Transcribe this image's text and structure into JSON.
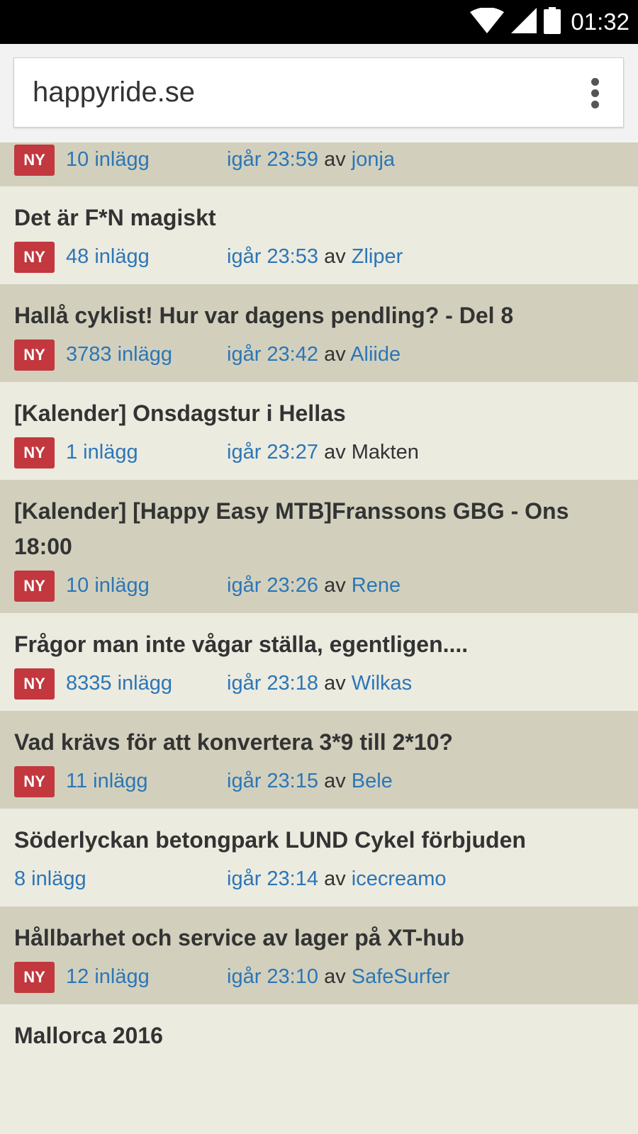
{
  "status_bar": {
    "time": "01:32",
    "icons": [
      "wifi-icon",
      "signal-icon",
      "battery-icon"
    ]
  },
  "browser": {
    "url": "happyride.se",
    "menu_icon": "overflow-menu-icon"
  },
  "colors": {
    "row_dark": "#d2d0bd",
    "row_light": "#ecebe0",
    "badge": "#c2383e",
    "link": "#2c76b6"
  },
  "threads": [
    {
      "title": "",
      "new_badge": "NY",
      "posts": "10 inlägg",
      "time": "igår 23:59",
      "by": "av",
      "user": "jonja"
    },
    {
      "title": "Det är F*N magiskt",
      "new_badge": "NY",
      "posts": "48 inlägg",
      "time": "igår 23:53",
      "by": "av",
      "user": "Zliper"
    },
    {
      "title": "Hallå cyklist! Hur var dagens pendling? - Del 8",
      "new_badge": "NY",
      "posts": "3783 inlägg",
      "time": "igår 23:42",
      "by": "av",
      "user": "Aliide"
    },
    {
      "title": "[Kalender] Onsdagstur i Hellas",
      "new_badge": "NY",
      "posts": "1 inlägg",
      "time": "igår 23:27",
      "by": "av",
      "user": "Makten"
    },
    {
      "title": "[Kalender] [Happy Easy MTB]Franssons GBG - Ons 18:00",
      "new_badge": "NY",
      "posts": "10 inlägg",
      "time": "igår 23:26",
      "by": "av",
      "user": "Rene"
    },
    {
      "title": "Frågor man inte vågar ställa, egentligen....",
      "new_badge": "NY",
      "posts": "8335 inlägg",
      "time": "igår 23:18",
      "by": "av",
      "user": "Wilkas"
    },
    {
      "title": "Vad krävs för att konvertera 3*9 till 2*10?",
      "new_badge": "NY",
      "posts": "11 inlägg",
      "time": "igår 23:15",
      "by": "av",
      "user": "Bele"
    },
    {
      "title": "Söderlyckan betongpark LUND Cykel förbjuden",
      "new_badge": "",
      "posts": "8 inlägg",
      "time": "igår 23:14",
      "by": "av",
      "user": "icecreamo"
    },
    {
      "title": "Hållbarhet och service av lager på XT-hub",
      "new_badge": "NY",
      "posts": "12 inlägg",
      "time": "igår 23:10",
      "by": "av",
      "user": "SafeSurfer"
    },
    {
      "title": "Mallorca 2016",
      "new_badge": "",
      "posts": "",
      "time": "",
      "by": "",
      "user": ""
    }
  ]
}
